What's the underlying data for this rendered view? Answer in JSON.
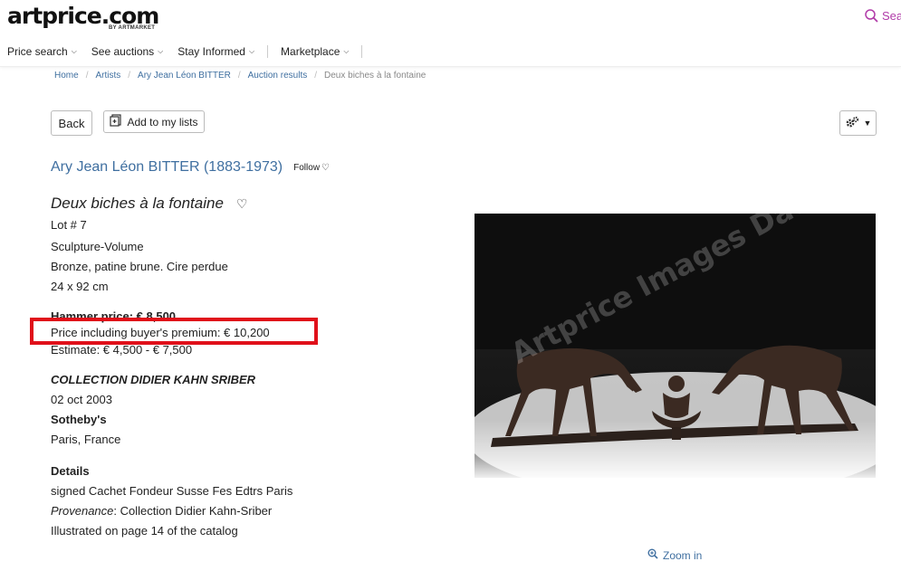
{
  "header": {
    "logo_main": "artprice.com",
    "logo_sub": "BY ARTMARKET",
    "search_label": "Sea",
    "nav": [
      {
        "label": "Price search"
      },
      {
        "label": "See auctions"
      },
      {
        "label": "Stay Informed"
      },
      {
        "label": "Marketplace"
      }
    ]
  },
  "breadcrumb": [
    "Home",
    "Artists",
    "Ary Jean Léon BITTER",
    "Auction results",
    "Deux biches à la fontaine"
  ],
  "toolbar": {
    "back_label": "Back",
    "add_lists_label": "Add to my lists"
  },
  "artist": {
    "name": "Ary Jean Léon BITTER (1883-1973)",
    "follow_label": "Follow"
  },
  "lot": {
    "title": "Deux biches à la fontaine",
    "lot_number": "Lot # 7",
    "category": "Sculpture-Volume",
    "medium": "Bronze, patine brune. Cire perdue",
    "dimensions": "24 x 92 cm",
    "hammer_price": "Hammer price: € 8,500",
    "price_premium": "Price including buyer's premium: € 10,200",
    "estimate": "Estimate: € 4,500 - € 7,500",
    "sale_name": "COLLECTION DIDIER KAHN SRIBER",
    "sale_date": "02 oct 2003",
    "auction_house": "Sotheby's",
    "location": "Paris, France",
    "details_heading": "Details",
    "details_signed": "signed Cachet Fondeur Susse Fes Edtrs Paris",
    "provenance_label": "Provenance",
    "provenance_value": ": Collection Didier Kahn-Sriber",
    "illustrated": "Illustrated on page 14 of the catalog"
  },
  "image": {
    "watermark": "Artprice Images Database",
    "zoom_label": "Zoom in"
  },
  "colors": {
    "link": "#3f6fa0",
    "highlight": "#e0101a",
    "search_accent": "#b03aa8"
  }
}
